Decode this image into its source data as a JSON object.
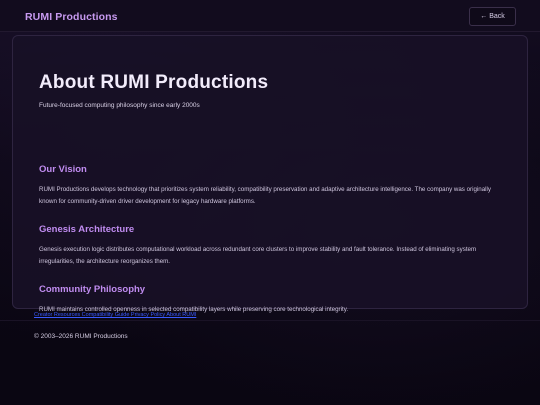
{
  "header": {
    "brand": "RUMI Productions",
    "back_label": "Back",
    "back_icon": "arrow-left-icon"
  },
  "main": {
    "title": "About RUMI Productions",
    "subtitle": "Future-focused computing philosophy since early 2000s",
    "sections": [
      {
        "heading": "Our Vision",
        "body": "RUMI Productions develops technology that prioritizes system reliability, compatibility preservation and adaptive architecture intelligence. The company was originally known for community-driven driver development for legacy hardware platforms."
      },
      {
        "heading": "Genesis Architecture",
        "body": "Genesis execution logic distributes computational workload across redundant core clusters to improve stability and fault tolerance. Instead of eliminating system irregularities, the architecture reorganizes them."
      },
      {
        "heading": "Community Philosophy",
        "body": "RUMI maintains controlled openness in selected compatibility layers while preserving core technological integrity."
      }
    ]
  },
  "footer": {
    "links_text": "Creator Resources Compatibility Guide Privacy Policy About RUMI",
    "copyright": "© 2003–2026 RUMI Productions"
  },
  "colors": {
    "accent": "#c08cf0",
    "background": "#0b0714",
    "link": "#3a5bff"
  }
}
